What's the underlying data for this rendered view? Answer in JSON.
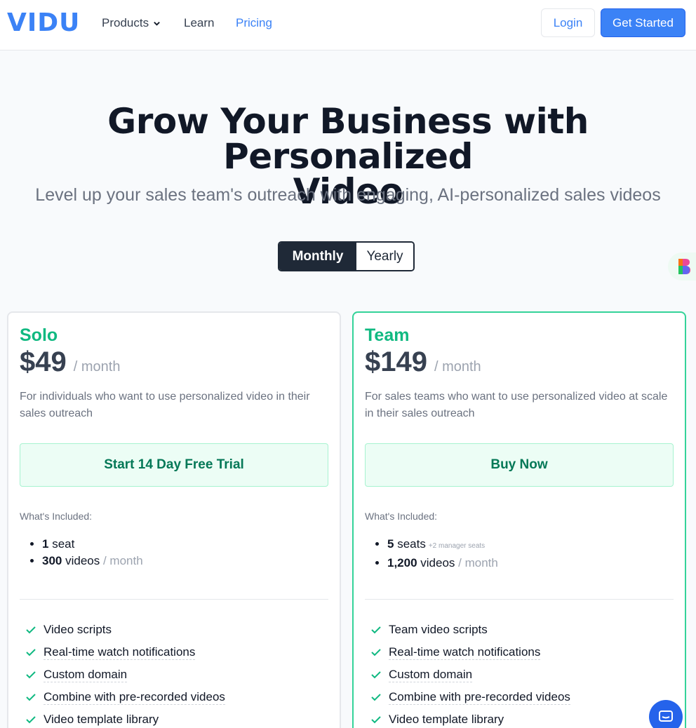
{
  "header": {
    "logo": "VIDU",
    "nav": [
      {
        "label": "Products"
      },
      {
        "label": "Learn"
      },
      {
        "label": "Pricing"
      }
    ],
    "login_label": "Login",
    "get_started_label": "Get Started"
  },
  "hero": {
    "title_line1": "Grow Your Business with Personalized",
    "title_line2": "Video",
    "subtitle": "Level up your sales team's outreach with engaging, AI-personalized sales videos"
  },
  "billing_toggle": {
    "monthly": "Monthly",
    "yearly": "Yearly",
    "selected": "Monthly"
  },
  "plans": [
    {
      "name": "Solo",
      "price": "$49",
      "period": "/ month",
      "description": "For individuals who want to use personalized video in their sales outreach",
      "cta": "Start 14 Day Free Trial",
      "included_label": "What's Included:",
      "included": [
        {
          "bold": "1",
          "text": " seat",
          "extra": ""
        },
        {
          "bold": "300",
          "text": " videos ",
          "muted": "/ month"
        }
      ],
      "features": [
        "Video scripts",
        "Real-time watch notifications",
        "Custom domain",
        "Combine with pre-recorded videos",
        "Video template library"
      ]
    },
    {
      "name": "Team",
      "price": "$149",
      "period": "/ month",
      "description": "For sales teams who want to use personalized video at scale in their sales outreach",
      "cta": "Buy Now",
      "included_label": "What's Included:",
      "included": [
        {
          "bold": "5",
          "text": " seats",
          "extra": "+2 manager seats"
        },
        {
          "bold": "1,200",
          "text": " videos ",
          "muted": "/ month"
        }
      ],
      "features": [
        "Team video scripts",
        "Real-time watch notifications",
        "Custom domain",
        "Combine with pre-recorded videos",
        "Video template library"
      ]
    }
  ],
  "colors": {
    "brand_blue": "#3b82f6",
    "plan_green": "#10b981",
    "dark": "#1f2937"
  },
  "icons": [
    "chevron-down-icon",
    "check-icon",
    "chat-icon",
    "floating-app-icon"
  ]
}
